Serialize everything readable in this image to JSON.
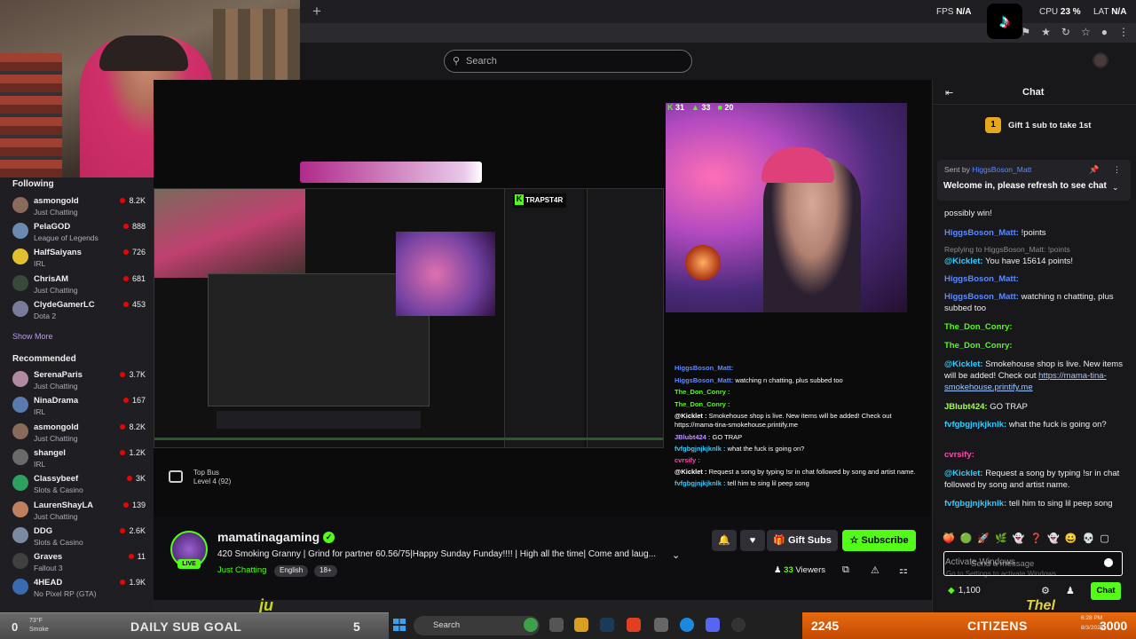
{
  "browser": {
    "new_tab": "+",
    "fps_label": "FPS",
    "fps_value": "N/A",
    "cpu_label": "CPU",
    "cpu_value": "23 %",
    "lat_label": "LAT",
    "lat_value": "N/A"
  },
  "topnav": {
    "search_placeholder": "Search"
  },
  "sidebar": {
    "following_header": "Following",
    "following": [
      {
        "name": "asmongold",
        "category": "Just Chatting",
        "viewers": "8.2K",
        "color": "#8a6a5a"
      },
      {
        "name": "PelaGOD",
        "category": "League of Legends",
        "viewers": "888",
        "color": "#6a8ab0"
      },
      {
        "name": "HalfSaiyans",
        "category": "IRL",
        "viewers": "726",
        "color": "#e0c030"
      },
      {
        "name": "ChrisAM",
        "category": "Just Chatting",
        "viewers": "681",
        "color": "#3a4a3a"
      },
      {
        "name": "ClydeGamerLC",
        "category": "Dota 2",
        "viewers": "453",
        "color": "#7a7a9a"
      }
    ],
    "show_more": "Show More",
    "recommended_header": "Recommended",
    "recommended": [
      {
        "name": "SerenaParis",
        "category": "Just Chatting",
        "viewers": "3.7K",
        "color": "#b08aa0"
      },
      {
        "name": "NinaDrama",
        "category": "IRL",
        "viewers": "167",
        "color": "#5a7ab0"
      },
      {
        "name": "asmongold",
        "category": "Just Chatting",
        "viewers": "8.2K",
        "color": "#8a6a5a"
      },
      {
        "name": "shangel",
        "category": "IRL",
        "viewers": "1.2K",
        "color": "#6a6a6a"
      },
      {
        "name": "Classybeef",
        "category": "Slots & Casino",
        "viewers": "3K",
        "color": "#30a060"
      },
      {
        "name": "LaurenShayLA",
        "category": "Just Chatting",
        "viewers": "139",
        "color": "#c08060"
      },
      {
        "name": "DDG",
        "category": "Slots & Casino",
        "viewers": "2.6K",
        "color": "#7a8aa0"
      },
      {
        "name": "Graves",
        "category": "Fallout 3",
        "viewers": "11",
        "color": "#404040"
      },
      {
        "name": "4HEAD",
        "category": "No Pixel RP (GTA)",
        "viewers": "1.9K",
        "color": "#3a6ab0"
      }
    ]
  },
  "player": {
    "kick_stats": {
      "a": "31",
      "b": "33",
      "c": "20"
    },
    "nested_brand": "TRAPST4R",
    "overlay_chat": [
      {
        "user": "HiggsBoson_Matt:",
        "msg": "",
        "color": "#5b8aff"
      },
      {
        "user": "HiggsBoson_Matt:",
        "msg": "watching n chatting, plus subbed too",
        "color": "#5b8aff"
      },
      {
        "user": "The_Don_Conry :",
        "msg": "",
        "color": "#53fc18"
      },
      {
        "user": "The_Don_Conry :",
        "msg": "",
        "color": "#53fc18"
      },
      {
        "user": "@Kicklet :",
        "msg": "Smokehouse shop is live. New items will be added! Check out https://mama-tina-smokehouse.printify.me",
        "color": "#ffffff"
      },
      {
        "user": "JBlubt424 :",
        "msg": "GO TRAP",
        "color": "#bf94ff"
      },
      {
        "user": "fvfgbgjnjkjknlk :",
        "msg": "what the fuck is going on?",
        "color": "#33ccff"
      },
      {
        "user": "cvrsify :",
        "msg": "",
        "color": "#ff4ab0"
      },
      {
        "user": "@Kicklet :",
        "msg": "Request a song by typing !sr in chat followed by song and artist name.",
        "color": "#ffffff"
      },
      {
        "user": "fvfgbgjnjkjknlk :",
        "msg": "tell him to sing lil peep song",
        "color": "#33ccff"
      }
    ],
    "top_bus_label": "Top Bus",
    "top_bus_level": "Level 4",
    "top_bus_progress": "(92)"
  },
  "stream": {
    "channel": "mamatinagaming",
    "live_badge": "LIVE",
    "title": "420 Smoking Granny | Grind for partner 60.56/75|Happy Sunday Funday!!!! | High all the time| Come and laug...",
    "category": "Just Chatting",
    "tags": [
      "English",
      "18+"
    ],
    "gift_subs": "Gift Subs",
    "subscribe": "Subscribe",
    "viewer_count": "33",
    "viewer_label": "Viewers"
  },
  "chat": {
    "title": "Chat",
    "gift_badge": "1",
    "gift_text": "Gift 1 sub to take 1st",
    "pinned_prefix": "Sent by",
    "pinned_user": "HiggsBoson_Matt",
    "pinned_msg": "Welcome in, please refresh to see chat",
    "messages": [
      {
        "user": "",
        "text": "possibly win!",
        "reply": "",
        "color": "#efeff1"
      },
      {
        "user": "HiggsBoson_Matt:",
        "text": "!points",
        "reply": "",
        "color": "#5b8aff"
      },
      {
        "user": "@Kicklet:",
        "text": "You have 15614 points!",
        "reply": "Replying to HiggsBoson_Matt: !points",
        "color": "#33ccff"
      },
      {
        "user": "HiggsBoson_Matt:",
        "text": "",
        "reply": "",
        "color": "#5b8aff"
      },
      {
        "user": "HiggsBoson_Matt:",
        "text": "watching n chatting, plus subbed too",
        "reply": "",
        "color": "#5b8aff"
      },
      {
        "user": "The_Don_Conry:",
        "text": "",
        "reply": "",
        "color": "#53fc18"
      },
      {
        "user": "The_Don_Conry:",
        "text": "",
        "reply": "",
        "color": "#53fc18"
      },
      {
        "user": "@Kicklet:",
        "text": "Smokehouse shop is live. New items will be added! Check out",
        "link": "https://mama-tina-smokehouse.printify.me",
        "reply": "",
        "color": "#33ccff"
      },
      {
        "user": "JBlubt424:",
        "text": "GO TRAP",
        "reply": "",
        "color": "#a0ff50"
      },
      {
        "user": "fvfgbgjnjkjknlk:",
        "text": "what the fuck is going on?",
        "reply": "",
        "color": "#33ccff"
      },
      {
        "user": "cvrsify:",
        "text": "",
        "reply": "",
        "color": "#ff4ab0"
      },
      {
        "user": "@Kicklet:",
        "text": "Request a song by typing !sr in chat followed by song and artist name.",
        "reply": "",
        "color": "#33ccff"
      },
      {
        "user": "fvfgbgjnjkjknlk:",
        "text": "tell him to sing lil peep song",
        "reply": "",
        "color": "#33ccff"
      }
    ],
    "input_placeholder": "Send a message",
    "activate_title": "Activate Windows",
    "activate_sub": "Go to Settings to activate Windows.",
    "points": "1,100",
    "chat_button": "Chat"
  },
  "overlay": {
    "subgoal_count": "0",
    "weather_temp": "73°F",
    "weather_cond": "Smoke",
    "subgoal_label": "DAILY SUB GOAL",
    "subgoal_target": "5",
    "citizens_count": "2245",
    "citizens_label": "CITIZENS",
    "citizens_target": "3000",
    "ju_text": "ju",
    "thel_text": "Thel",
    "clock_time": "6:28 PM",
    "clock_date": "8/3/2025"
  },
  "taskbar": {
    "search_label": "Search"
  }
}
